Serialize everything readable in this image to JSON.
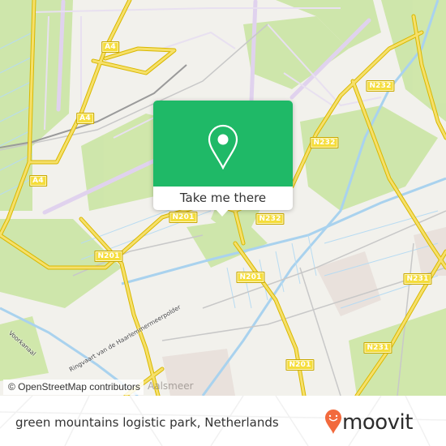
{
  "map": {
    "road_shields": [
      {
        "id": "a4-1",
        "label": "A4"
      },
      {
        "id": "a4-2",
        "label": "A4"
      },
      {
        "id": "a4-3",
        "label": "A4"
      },
      {
        "id": "a4-4",
        "label": "A4"
      },
      {
        "id": "n232-1",
        "label": "N232"
      },
      {
        "id": "n232-2",
        "label": "N232"
      },
      {
        "id": "n232-3",
        "label": "N232"
      },
      {
        "id": "n201-1",
        "label": "N201"
      },
      {
        "id": "n201-2",
        "label": "N201"
      },
      {
        "id": "n201-3",
        "label": "N201"
      },
      {
        "id": "n201-4",
        "label": "N201"
      },
      {
        "id": "n231-1",
        "label": "N231"
      },
      {
        "id": "n231-2",
        "label": "N231"
      }
    ],
    "place_labels": {
      "voorkanaal": "Voorkanaal",
      "ringvaart": "Ringvaart van de Haarlemmermeerpolder",
      "town": "Aalsmeer"
    },
    "attribution": "© OpenStreetMap contributors"
  },
  "popup": {
    "icon": "map-pin-icon",
    "cta_label": "Take me there",
    "accent_color": "#1fb967"
  },
  "footer": {
    "place_name": "green mountains logistic park, Netherlands",
    "brand": "moovit",
    "brand_color": "#f26a3d"
  }
}
